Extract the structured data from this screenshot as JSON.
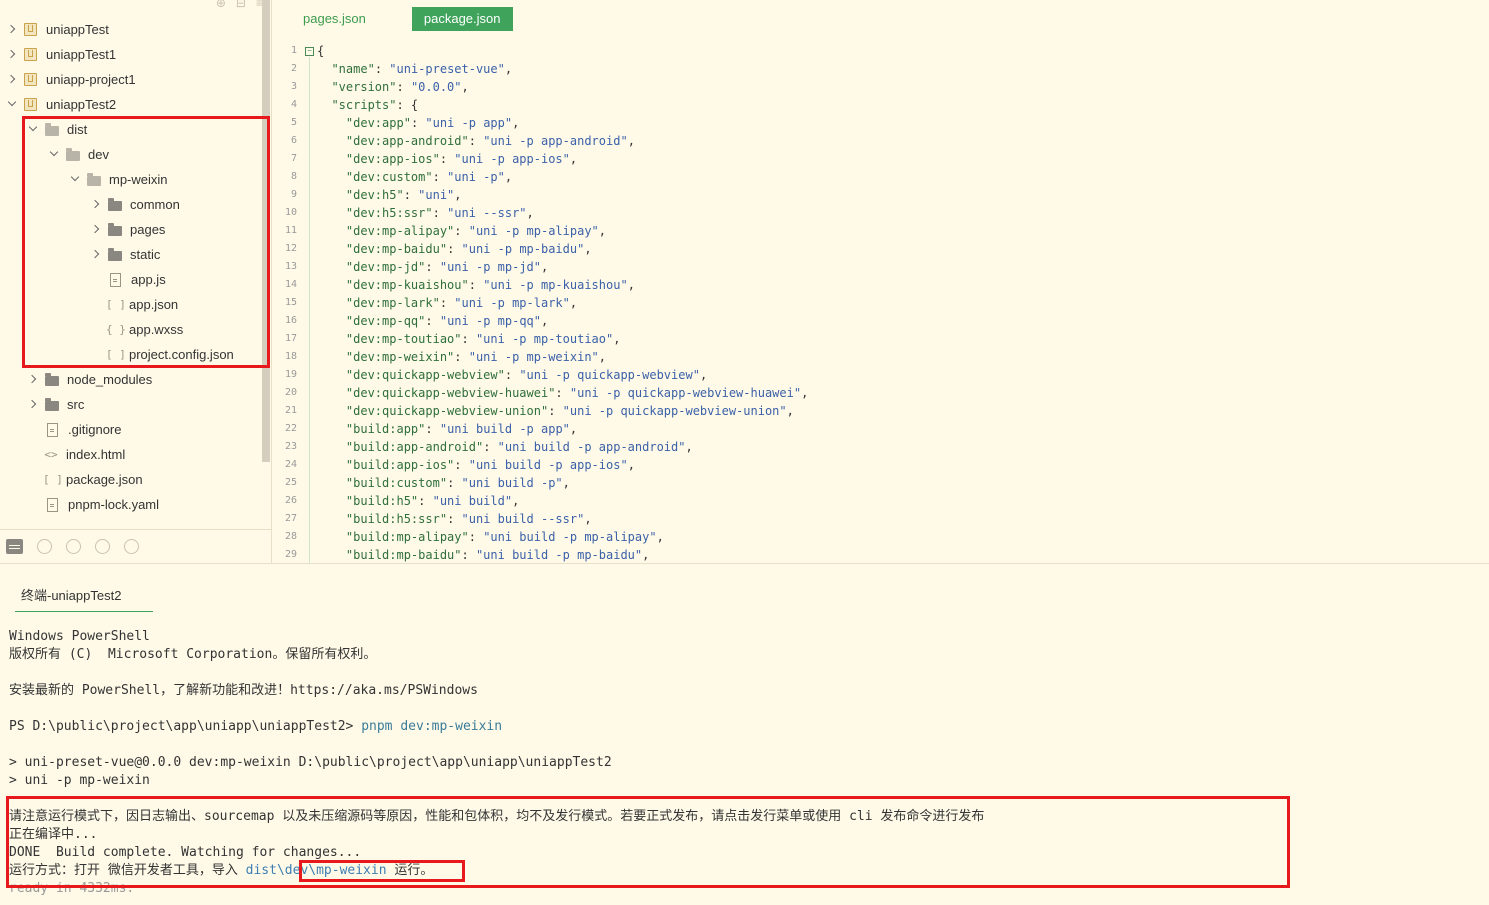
{
  "sidebar": {
    "tree": [
      {
        "label": "uniappTest",
        "depth": 0,
        "icon": "project-icon",
        "chevron": "right"
      },
      {
        "label": "uniappTest1",
        "depth": 0,
        "icon": "project-icon",
        "chevron": "right"
      },
      {
        "label": "uniapp-project1",
        "depth": 0,
        "icon": "project-icon",
        "chevron": "right"
      },
      {
        "label": "uniappTest2",
        "depth": 0,
        "icon": "project-icon",
        "chevron": "down"
      },
      {
        "label": "dist",
        "depth": 1,
        "icon": "folder-open-icon",
        "chevron": "down"
      },
      {
        "label": "dev",
        "depth": 2,
        "icon": "folder-open-icon",
        "chevron": "down"
      },
      {
        "label": "mp-weixin",
        "depth": 3,
        "icon": "folder-open-icon",
        "chevron": "down"
      },
      {
        "label": "common",
        "depth": 4,
        "icon": "folder-icon",
        "chevron": "right"
      },
      {
        "label": "pages",
        "depth": 4,
        "icon": "folder-icon",
        "chevron": "right"
      },
      {
        "label": "static",
        "depth": 4,
        "icon": "folder-icon",
        "chevron": "right"
      },
      {
        "label": "app.js",
        "depth": 4,
        "icon": "js-file-icon",
        "chevron": "none"
      },
      {
        "label": "app.json",
        "depth": 4,
        "icon": "json-file-icon",
        "chevron": "none"
      },
      {
        "label": "app.wxss",
        "depth": 4,
        "icon": "css-file-icon",
        "chevron": "none"
      },
      {
        "label": "project.config.json",
        "depth": 4,
        "icon": "json-file-icon",
        "chevron": "none"
      },
      {
        "label": "node_modules",
        "depth": 1,
        "icon": "folder-icon",
        "chevron": "right"
      },
      {
        "label": "src",
        "depth": 1,
        "icon": "folder-icon",
        "chevron": "right"
      },
      {
        "label": ".gitignore",
        "depth": 1,
        "icon": "file-icon",
        "chevron": "none"
      },
      {
        "label": "index.html",
        "depth": 1,
        "icon": "html-file-icon",
        "chevron": "none"
      },
      {
        "label": "package.json",
        "depth": 1,
        "icon": "json-file-icon",
        "chevron": "none"
      },
      {
        "label": "pnpm-lock.yaml",
        "depth": 1,
        "icon": "file-icon",
        "chevron": "none"
      }
    ],
    "toolbar_icons": [
      "project-manager-icon",
      "extensions-icon",
      "debug-icon",
      "source-control-icon",
      "browser-icon"
    ]
  },
  "editor": {
    "tabs": [
      {
        "label": "pages.json",
        "active": false
      },
      {
        "label": "package.json",
        "active": true
      }
    ],
    "code_lines": [
      {
        "n": "1",
        "parts": [
          [
            "p",
            "{"
          ]
        ]
      },
      {
        "n": "2",
        "parts": [
          [
            "p",
            "  "
          ],
          [
            "k",
            "\"name\""
          ],
          [
            "p",
            ": "
          ],
          [
            "v",
            "\"uni-preset-vue\""
          ],
          [
            "p",
            ","
          ]
        ]
      },
      {
        "n": "3",
        "parts": [
          [
            "p",
            "  "
          ],
          [
            "k",
            "\"version\""
          ],
          [
            "p",
            ": "
          ],
          [
            "v",
            "\"0.0.0\""
          ],
          [
            "p",
            ","
          ]
        ]
      },
      {
        "n": "4",
        "parts": [
          [
            "p",
            "  "
          ],
          [
            "k",
            "\"scripts\""
          ],
          [
            "p",
            ": {"
          ]
        ]
      },
      {
        "n": "5",
        "parts": [
          [
            "p",
            "    "
          ],
          [
            "k",
            "\"dev:app\""
          ],
          [
            "p",
            ": "
          ],
          [
            "v",
            "\"uni -p app\""
          ],
          [
            "p",
            ","
          ]
        ]
      },
      {
        "n": "6",
        "parts": [
          [
            "p",
            "    "
          ],
          [
            "k",
            "\"dev:app-android\""
          ],
          [
            "p",
            ": "
          ],
          [
            "v",
            "\"uni -p app-android\""
          ],
          [
            "p",
            ","
          ]
        ]
      },
      {
        "n": "7",
        "parts": [
          [
            "p",
            "    "
          ],
          [
            "k",
            "\"dev:app-ios\""
          ],
          [
            "p",
            ": "
          ],
          [
            "v",
            "\"uni -p app-ios\""
          ],
          [
            "p",
            ","
          ]
        ]
      },
      {
        "n": "8",
        "parts": [
          [
            "p",
            "    "
          ],
          [
            "k",
            "\"dev:custom\""
          ],
          [
            "p",
            ": "
          ],
          [
            "v",
            "\"uni -p\""
          ],
          [
            "p",
            ","
          ]
        ]
      },
      {
        "n": "9",
        "parts": [
          [
            "p",
            "    "
          ],
          [
            "k",
            "\"dev:h5\""
          ],
          [
            "p",
            ": "
          ],
          [
            "v",
            "\"uni\""
          ],
          [
            "p",
            ","
          ]
        ]
      },
      {
        "n": "10",
        "parts": [
          [
            "p",
            "    "
          ],
          [
            "k",
            "\"dev:h5:ssr\""
          ],
          [
            "p",
            ": "
          ],
          [
            "v",
            "\"uni --ssr\""
          ],
          [
            "p",
            ","
          ]
        ]
      },
      {
        "n": "11",
        "parts": [
          [
            "p",
            "    "
          ],
          [
            "k",
            "\"dev:mp-alipay\""
          ],
          [
            "p",
            ": "
          ],
          [
            "v",
            "\"uni -p mp-alipay\""
          ],
          [
            "p",
            ","
          ]
        ]
      },
      {
        "n": "12",
        "parts": [
          [
            "p",
            "    "
          ],
          [
            "k",
            "\"dev:mp-baidu\""
          ],
          [
            "p",
            ": "
          ],
          [
            "v",
            "\"uni -p mp-baidu\""
          ],
          [
            "p",
            ","
          ]
        ]
      },
      {
        "n": "13",
        "parts": [
          [
            "p",
            "    "
          ],
          [
            "k",
            "\"dev:mp-jd\""
          ],
          [
            "p",
            ": "
          ],
          [
            "v",
            "\"uni -p mp-jd\""
          ],
          [
            "p",
            ","
          ]
        ]
      },
      {
        "n": "14",
        "parts": [
          [
            "p",
            "    "
          ],
          [
            "k",
            "\"dev:mp-kuaishou\""
          ],
          [
            "p",
            ": "
          ],
          [
            "v",
            "\"uni -p mp-kuaishou\""
          ],
          [
            "p",
            ","
          ]
        ]
      },
      {
        "n": "15",
        "parts": [
          [
            "p",
            "    "
          ],
          [
            "k",
            "\"dev:mp-lark\""
          ],
          [
            "p",
            ": "
          ],
          [
            "v",
            "\"uni -p mp-lark\""
          ],
          [
            "p",
            ","
          ]
        ]
      },
      {
        "n": "16",
        "parts": [
          [
            "p",
            "    "
          ],
          [
            "k",
            "\"dev:mp-qq\""
          ],
          [
            "p",
            ": "
          ],
          [
            "v",
            "\"uni -p mp-qq\""
          ],
          [
            "p",
            ","
          ]
        ]
      },
      {
        "n": "17",
        "parts": [
          [
            "p",
            "    "
          ],
          [
            "k",
            "\"dev:mp-toutiao\""
          ],
          [
            "p",
            ": "
          ],
          [
            "v",
            "\"uni -p mp-toutiao\""
          ],
          [
            "p",
            ","
          ]
        ]
      },
      {
        "n": "18",
        "parts": [
          [
            "p",
            "    "
          ],
          [
            "k",
            "\"dev:mp-weixin\""
          ],
          [
            "p",
            ": "
          ],
          [
            "v",
            "\"uni -p mp-weixin\""
          ],
          [
            "p",
            ","
          ]
        ]
      },
      {
        "n": "19",
        "parts": [
          [
            "p",
            "    "
          ],
          [
            "k",
            "\"dev:quickapp-webview\""
          ],
          [
            "p",
            ": "
          ],
          [
            "v",
            "\"uni -p quickapp-webview\""
          ],
          [
            "p",
            ","
          ]
        ]
      },
      {
        "n": "20",
        "parts": [
          [
            "p",
            "    "
          ],
          [
            "k",
            "\"dev:quickapp-webview-huawei\""
          ],
          [
            "p",
            ": "
          ],
          [
            "v",
            "\"uni -p quickapp-webview-huawei\""
          ],
          [
            "p",
            ","
          ]
        ]
      },
      {
        "n": "21",
        "parts": [
          [
            "p",
            "    "
          ],
          [
            "k",
            "\"dev:quickapp-webview-union\""
          ],
          [
            "p",
            ": "
          ],
          [
            "v",
            "\"uni -p quickapp-webview-union\""
          ],
          [
            "p",
            ","
          ]
        ]
      },
      {
        "n": "22",
        "parts": [
          [
            "p",
            "    "
          ],
          [
            "k",
            "\"build:app\""
          ],
          [
            "p",
            ": "
          ],
          [
            "v",
            "\"uni build -p app\""
          ],
          [
            "p",
            ","
          ]
        ]
      },
      {
        "n": "23",
        "parts": [
          [
            "p",
            "    "
          ],
          [
            "k",
            "\"build:app-android\""
          ],
          [
            "p",
            ": "
          ],
          [
            "v",
            "\"uni build -p app-android\""
          ],
          [
            "p",
            ","
          ]
        ]
      },
      {
        "n": "24",
        "parts": [
          [
            "p",
            "    "
          ],
          [
            "k",
            "\"build:app-ios\""
          ],
          [
            "p",
            ": "
          ],
          [
            "v",
            "\"uni build -p app-ios\""
          ],
          [
            "p",
            ","
          ]
        ]
      },
      {
        "n": "25",
        "parts": [
          [
            "p",
            "    "
          ],
          [
            "k",
            "\"build:custom\""
          ],
          [
            "p",
            ": "
          ],
          [
            "v",
            "\"uni build -p\""
          ],
          [
            "p",
            ","
          ]
        ]
      },
      {
        "n": "26",
        "parts": [
          [
            "p",
            "    "
          ],
          [
            "k",
            "\"build:h5\""
          ],
          [
            "p",
            ": "
          ],
          [
            "v",
            "\"uni build\""
          ],
          [
            "p",
            ","
          ]
        ]
      },
      {
        "n": "27",
        "parts": [
          [
            "p",
            "    "
          ],
          [
            "k",
            "\"build:h5:ssr\""
          ],
          [
            "p",
            ": "
          ],
          [
            "v",
            "\"uni build --ssr\""
          ],
          [
            "p",
            ","
          ]
        ]
      },
      {
        "n": "28",
        "parts": [
          [
            "p",
            "    "
          ],
          [
            "k",
            "\"build:mp-alipay\""
          ],
          [
            "p",
            ": "
          ],
          [
            "v",
            "\"uni build -p mp-alipay\""
          ],
          [
            "p",
            ","
          ]
        ]
      },
      {
        "n": "29",
        "parts": [
          [
            "p",
            "    "
          ],
          [
            "k",
            "\"build:mp-baidu\""
          ],
          [
            "p",
            ": "
          ],
          [
            "v",
            "\"uni build -p mp-baidu\""
          ],
          [
            "p",
            ","
          ]
        ]
      }
    ]
  },
  "terminal": {
    "tab_label": "终端-uniappTest2",
    "line1": "Windows PowerShell",
    "line2": "版权所有 (C)  Microsoft Corporation。保留所有权利。",
    "line3": "安装最新的 PowerShell，了解新功能和改进！https://aka.ms/PSWindows",
    "prompt": "PS D:\\public\\project\\app\\uniapp\\uniappTest2> ",
    "prompt_cmd": "pnpm dev:mp-weixin",
    "line5": "> uni-preset-vue@0.0.0 dev:mp-weixin D:\\public\\project\\app\\uniapp\\uniappTest2",
    "line6": "> uni -p mp-weixin",
    "line7": "请注意运行模式下，因日志输出、sourcemap 以及未压缩源码等原因，性能和包体积，均不及发行模式。若要正式发布，请点击发行菜单或使用 cli 发布命令进行发布",
    "line8": "正在编译中...",
    "line9": "DONE  Build complete. Watching for changes...",
    "line10_prefix": "运行方式：打开 微信开发者工具，导入 ",
    "line10_link": "dist\\dev\\mp-weixin",
    "line10_suffix": " 运行。",
    "line11": "ready in 4332ms."
  },
  "colors": {
    "background": "#fffae8",
    "accent_green": "#3fa35b",
    "highlight_red": "#e8191d",
    "json_key": "#2f6f3a",
    "json_value": "#3b61a8"
  }
}
